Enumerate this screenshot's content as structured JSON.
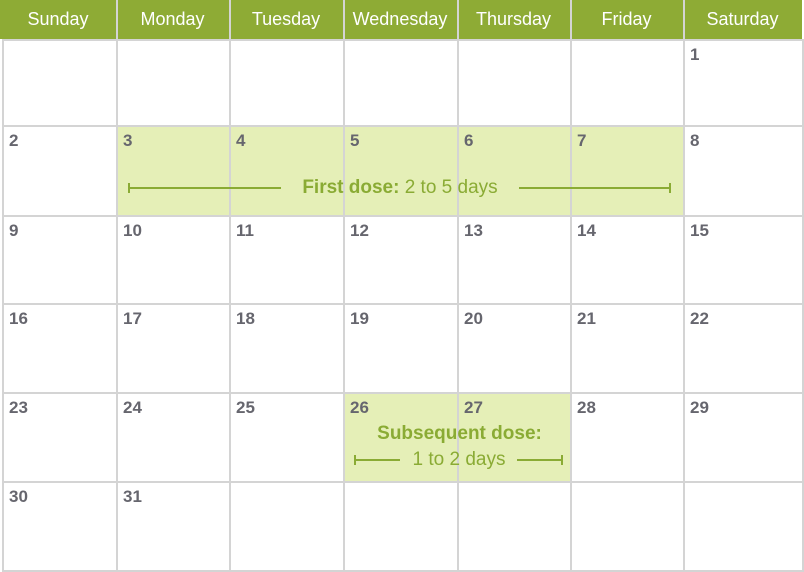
{
  "days_of_week": [
    "Sunday",
    "Monday",
    "Tuesday",
    "Wednesday",
    "Thursday",
    "Friday",
    "Saturday"
  ],
  "weeks": [
    [
      "",
      "",
      "",
      "",
      "",
      "",
      "1"
    ],
    [
      "2",
      "3",
      "4",
      "5",
      "6",
      "7",
      "8"
    ],
    [
      "9",
      "10",
      "11",
      "12",
      "13",
      "14",
      "15"
    ],
    [
      "16",
      "17",
      "18",
      "19",
      "20",
      "21",
      "22"
    ],
    [
      "23",
      "24",
      "25",
      "26",
      "27",
      "28",
      "29"
    ],
    [
      "30",
      "31",
      "",
      "",
      "",
      "",
      ""
    ]
  ],
  "annotations": {
    "first_dose": {
      "title": "First dose:",
      "text": " 2 to 5 days",
      "days": [
        "3",
        "4",
        "5",
        "6",
        "7"
      ]
    },
    "subsequent_dose": {
      "title": "Subsequent dose:",
      "text": "1 to 2 days",
      "days": [
        "26",
        "27"
      ]
    }
  },
  "colors": {
    "header": "#8eab35",
    "highlight": "#e5efb7",
    "accent_text": "#8aab34",
    "day_number": "#66666e",
    "grid": "#d4d4d4"
  }
}
